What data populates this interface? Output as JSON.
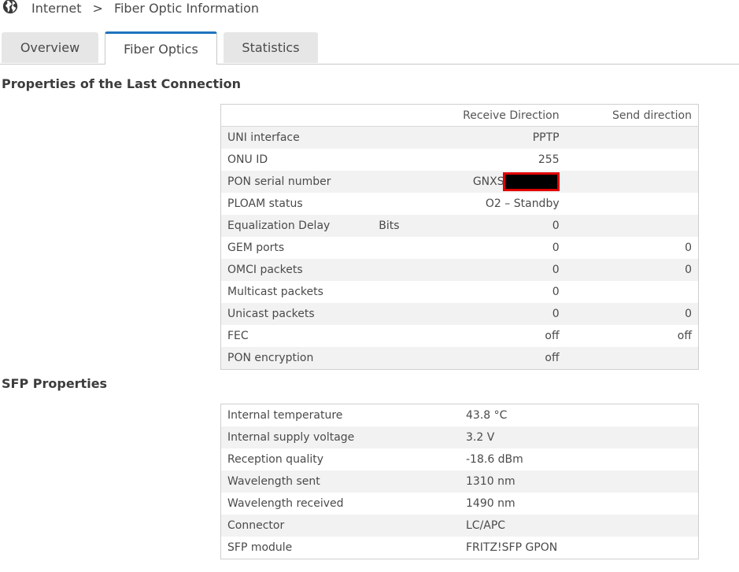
{
  "breadcrumb": {
    "home": "Internet",
    "separator": ">",
    "current": "Fiber Optic Information"
  },
  "tabs": [
    {
      "label": "Overview",
      "active": false
    },
    {
      "label": "Fiber Optics",
      "active": true
    },
    {
      "label": "Statistics",
      "active": false
    }
  ],
  "connection": {
    "title": "Properties of the Last Connection",
    "col_receive": "Receive Direction",
    "col_send": "Send direction",
    "rows": [
      {
        "label": "UNI interface",
        "unit": "",
        "receive": "PPTP",
        "send": ""
      },
      {
        "label": "ONU ID",
        "unit": "",
        "receive": "255",
        "send": ""
      },
      {
        "label": "PON serial number",
        "unit": "",
        "receive": "GNXS",
        "send": ""
      },
      {
        "label": "PLOAM status",
        "unit": "",
        "receive": "O2 – Standby",
        "send": ""
      },
      {
        "label": "Equalization Delay",
        "unit": "Bits",
        "receive": "0",
        "send": ""
      },
      {
        "label": "GEM ports",
        "unit": "",
        "receive": "0",
        "send": "0"
      },
      {
        "label": "OMCI packets",
        "unit": "",
        "receive": "0",
        "send": "0"
      },
      {
        "label": "Multicast packets",
        "unit": "",
        "receive": "0",
        "send": ""
      },
      {
        "label": "Unicast packets",
        "unit": "",
        "receive": "0",
        "send": "0"
      },
      {
        "label": "FEC",
        "unit": "",
        "receive": "off",
        "send": "off"
      },
      {
        "label": "PON encryption",
        "unit": "",
        "receive": "off",
        "send": ""
      }
    ]
  },
  "sfp": {
    "title": "SFP Properties",
    "rows": [
      {
        "label": "Internal temperature",
        "value": "43.8 °C"
      },
      {
        "label": "Internal supply voltage",
        "value": "3.2 V"
      },
      {
        "label": "Reception quality",
        "value": "-18.6 dBm"
      },
      {
        "label": "Wavelength sent",
        "value": "1310 nm"
      },
      {
        "label": "Wavelength received",
        "value": "1490 nm"
      },
      {
        "label": "Connector",
        "value": "LC/APC"
      },
      {
        "label": "SFP module",
        "value": "FRITZ!SFP GPON"
      }
    ]
  },
  "colors": {
    "accent": "#1e73be",
    "redaction_border": "#e00000"
  }
}
